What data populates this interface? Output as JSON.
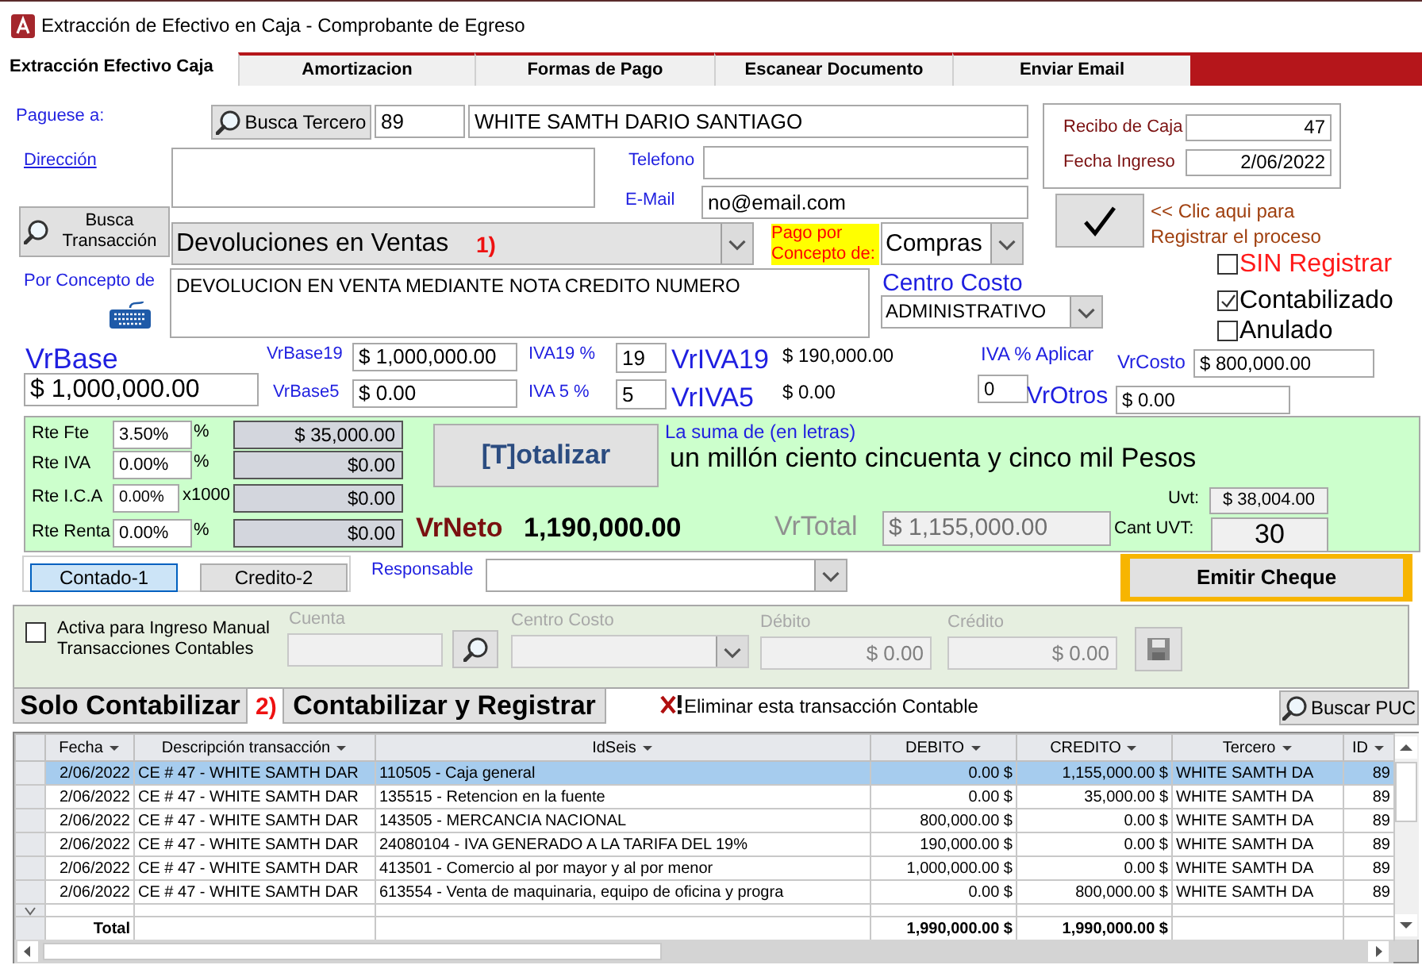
{
  "window": {
    "title": "Extracción de Efectivo en Caja - Comprobante de Egreso"
  },
  "tabs": [
    {
      "label": "Extracción Efectivo Caja",
      "selected": true
    },
    {
      "label": "Amortizacion",
      "selected": false
    },
    {
      "label": "Formas de Pago",
      "selected": false
    },
    {
      "label": "Escanear Documento",
      "selected": false
    },
    {
      "label": "Enviar Email",
      "selected": false
    }
  ],
  "payee": {
    "label": "Paguese a:",
    "search_button": "Busca Tercero",
    "code": "89",
    "name": "WHITE SAMTH DARIO SANTIAGO"
  },
  "address": {
    "label": "Dirección"
  },
  "phone": {
    "label": "Telefono"
  },
  "email": {
    "label": "E-Mail",
    "value": "no@email.com"
  },
  "receipt": {
    "label": "Recibo de Caja",
    "value": "47"
  },
  "entry_date": {
    "label": "Fecha Ingreso",
    "value": "2/06/2022"
  },
  "register_hint": "<< Clic aqui para Registrar el proceso",
  "search_transaction_button": "Busca Transacción",
  "transaction_type": {
    "value": "Devoluciones en Ventas",
    "step": "1)"
  },
  "payment_concept": {
    "label": "Pago por Concepto de:",
    "value": "Compras"
  },
  "concept": {
    "label": "Por Concepto de",
    "value": "DEVOLUCION EN VENTA MEDIANTE NOTA CREDITO NUMERO"
  },
  "cost_center": {
    "label": "Centro Costo",
    "value": "ADMINISTRATIVO"
  },
  "flags": [
    {
      "label": "SIN Registrar",
      "checked": false,
      "kind": "warning"
    },
    {
      "label": "Contabilizado",
      "checked": true,
      "kind": "normal"
    },
    {
      "label": "Anulado",
      "checked": false,
      "kind": "normal"
    }
  ],
  "amounts": {
    "vr_base": {
      "label": "VrBase",
      "value": "$ 1,000,000.00"
    },
    "vr_base19": {
      "label": "VrBase19",
      "value": "$ 1,000,000.00"
    },
    "vr_base5": {
      "label": "VrBase5",
      "value": "$ 0.00"
    },
    "iva19_pct": {
      "label": "IVA19 %",
      "value": "19"
    },
    "iva5_pct": {
      "label": "IVA 5 %",
      "value": "5"
    },
    "vr_iva19": {
      "label": "VrIVA19",
      "value": "$ 190,000.00"
    },
    "vr_iva5": {
      "label": "VrIVA5",
      "value": "$ 0.00"
    },
    "iva_apply": {
      "label": "IVA % Aplicar",
      "value": "0"
    },
    "vr_costo": {
      "label": "VrCosto",
      "value": "$ 800,000.00"
    },
    "vr_otros": {
      "label": "VrOtros",
      "value": "$ 0.00"
    }
  },
  "withholdings": [
    {
      "label": "Rte Fte",
      "rate": "3.50%",
      "unit": "%",
      "amount": "$ 35,000.00"
    },
    {
      "label": "Rte IVA",
      "rate": "0.00%",
      "unit": "%",
      "amount": "$0.00"
    },
    {
      "label": "Rte I.C.A",
      "rate": "0.00%",
      "unit": "x1000",
      "amount": "$0.00"
    },
    {
      "label": "Rte Renta",
      "rate": "0.00%",
      "unit": "%",
      "amount": "$0.00"
    }
  ],
  "totalize_button": "[T]otalizar",
  "amount_in_words": {
    "label": "La suma de (en letras)",
    "value": "un millón ciento cincuenta y cinco mil Pesos"
  },
  "vr_neto": {
    "label": "VrNeto",
    "value": "1,190,000.00"
  },
  "vr_total": {
    "label": "VrTotal",
    "value": "$ 1,155,000.00"
  },
  "uvt": {
    "label": "Uvt:",
    "value": "$ 38,004.00"
  },
  "cant_uvt": {
    "label": "Cant UVT:",
    "value": "30"
  },
  "payment_modes": [
    {
      "label": "Contado-1",
      "selected": true
    },
    {
      "label": "Credito-2",
      "selected": false
    }
  ],
  "responsible": {
    "label": "Responsable"
  },
  "issue_check_button": "Emitir Cheque",
  "manual_entry": {
    "checked": false,
    "label": "Activa para Ingreso Manual Transacciones Contables",
    "account_label": "Cuenta",
    "cost_center_label": "Centro Costo",
    "debit_label": "Débito",
    "debit": "$ 0.00",
    "credit_label": "Crédito",
    "credit": "$ 0.00"
  },
  "actions": {
    "post_only": "Solo Contabilizar",
    "step": "2)",
    "post_and_register": "Contabilizar y Registrar",
    "delete_link": "Eliminar esta transacción Contable",
    "search_puc": "Buscar PUC"
  },
  "table": {
    "columns": [
      "Fecha",
      "Descripción transacción",
      "IdSeis",
      "DEBITO",
      "CREDITO",
      "Tercero",
      "ID"
    ],
    "rows": [
      {
        "selected": true,
        "cells": [
          "2/06/2022",
          "CE # 47 - WHITE SAMTH DAR",
          "110505 - Caja general",
          "0.00 $",
          "1,155,000.00 $",
          "WHITE SAMTH DA",
          "89"
        ]
      },
      {
        "selected": false,
        "cells": [
          "2/06/2022",
          "CE # 47 - WHITE SAMTH DAR",
          "135515 - Retencion en la fuente",
          "0.00 $",
          "35,000.00 $",
          "WHITE SAMTH DA",
          "89"
        ]
      },
      {
        "selected": false,
        "cells": [
          "2/06/2022",
          "CE # 47 - WHITE SAMTH DAR",
          "143505 - MERCANCIA NACIONAL",
          "800,000.00 $",
          "0.00 $",
          "WHITE SAMTH DA",
          "89"
        ]
      },
      {
        "selected": false,
        "cells": [
          "2/06/2022",
          "CE # 47 - WHITE SAMTH DAR",
          "24080104 - IVA GENERADO A LA TARIFA DEL 19%",
          "190,000.00 $",
          "0.00 $",
          "WHITE SAMTH DA",
          "89"
        ]
      },
      {
        "selected": false,
        "cells": [
          "2/06/2022",
          "CE # 47 - WHITE SAMTH DAR",
          "413501 - Comercio al por mayor y al por menor",
          "1,000,000.00 $",
          "0.00 $",
          "WHITE SAMTH DA",
          "89"
        ]
      },
      {
        "selected": false,
        "cells": [
          "2/06/2022",
          "CE # 47 - WHITE SAMTH DAR",
          "613554 - Venta de maquinaria, equipo de oficina y progra",
          "0.00 $",
          "800,000.00 $",
          "WHITE SAMTH DA",
          "89"
        ]
      }
    ],
    "total": {
      "label": "Total",
      "debit": "1,990,000.00 $",
      "credit": "1,990,000.00 $"
    }
  }
}
